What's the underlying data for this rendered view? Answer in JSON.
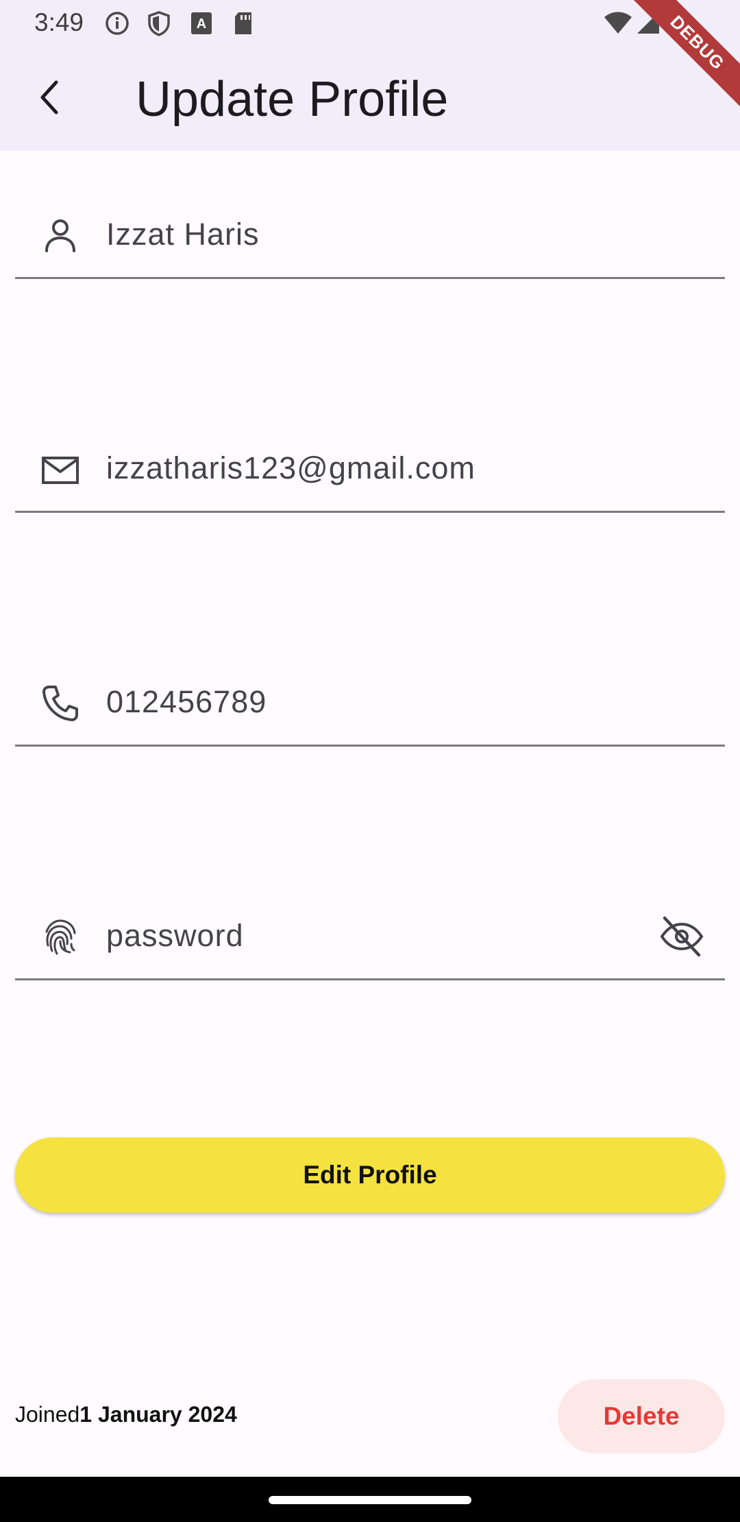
{
  "status": {
    "time": "3:49",
    "icons": [
      "info-icon",
      "shield-icon",
      "text-a-icon",
      "sd-card-icon",
      "wifi-icon",
      "signal-icon"
    ]
  },
  "debug_banner": "DEBUG",
  "appbar": {
    "title": "Update Profile",
    "back_icon": "chevron-left-icon"
  },
  "form": {
    "name": {
      "value": "Izzat Haris",
      "icon": "person-icon"
    },
    "email": {
      "value": "izzatharis123@gmail.com",
      "icon": "mail-icon"
    },
    "phone": {
      "value": "012456789",
      "icon": "phone-icon"
    },
    "password": {
      "value": "password",
      "icon": "fingerprint-icon",
      "toggle_icon": "eye-off-icon"
    }
  },
  "actions": {
    "edit_label": "Edit Profile",
    "delete_label": "Delete"
  },
  "footer": {
    "joined_prefix": "Joined",
    "joined_date": "1 January 2024"
  },
  "colors": {
    "appbar_bg": "#f2eef9",
    "page_bg": "#fffbfe",
    "edit_button": "#f5e240",
    "delete_text": "#e53935",
    "delete_bg": "#fde8e8",
    "debug_ribbon": "#b23a3a"
  }
}
